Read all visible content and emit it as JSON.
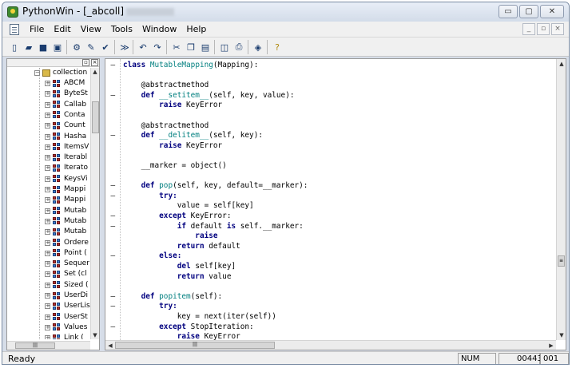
{
  "window": {
    "title": "PythonWin - [_abcoll]",
    "min_label": "▭",
    "max_label": "▢",
    "close_label": "✕"
  },
  "menu": [
    "File",
    "Edit",
    "View",
    "Tools",
    "Window",
    "Help"
  ],
  "toolbar": {
    "icons": [
      "new-file-icon",
      "open-folder-icon",
      "save-icon",
      "save-all-icon",
      "debug-icon",
      "edit-icon",
      "check-icon",
      "indent-icon",
      "undo-icon",
      "redo-icon",
      "cut-icon",
      "copy-icon",
      "paste-icon",
      "print-preview-icon",
      "print-icon",
      "browse-icon",
      "help-icon"
    ]
  },
  "tree": {
    "root": "collection",
    "items": [
      "ABCM",
      "ByteSt",
      "Callab",
      "Conta",
      "Count",
      "Hasha",
      "ItemsV",
      "Iterabl",
      "Iterato",
      "KeysVi",
      "Mappi",
      "Mappi",
      "Mutab",
      "Mutab",
      "Mutab",
      "Ordere",
      "Point (",
      "Sequer",
      "Set (cl",
      "Sized (",
      "UserDi",
      "UserLis",
      "UserSt",
      "Values",
      "Link ("
    ]
  },
  "code": [
    {
      "tokens": [
        [
          "kw",
          "class "
        ],
        [
          "nm",
          "MutableMapping"
        ],
        [
          "tx",
          "(Mapping):"
        ]
      ]
    },
    {
      "tokens": []
    },
    {
      "tokens": [
        [
          "tx",
          "    @abstractmethod"
        ]
      ]
    },
    {
      "tokens": [
        [
          "kw",
          "    def "
        ],
        [
          "fn",
          "__setitem__"
        ],
        [
          "tx",
          "(self, key, value):"
        ]
      ]
    },
    {
      "tokens": [
        [
          "kw",
          "        raise "
        ],
        [
          "tx",
          "KeyError"
        ]
      ]
    },
    {
      "tokens": []
    },
    {
      "tokens": [
        [
          "tx",
          "    @abstractmethod"
        ]
      ]
    },
    {
      "tokens": [
        [
          "kw",
          "    def "
        ],
        [
          "fn",
          "__delitem__"
        ],
        [
          "tx",
          "(self, key):"
        ]
      ]
    },
    {
      "tokens": [
        [
          "kw",
          "        raise "
        ],
        [
          "tx",
          "KeyError"
        ]
      ]
    },
    {
      "tokens": []
    },
    {
      "tokens": [
        [
          "tx",
          "    __marker = object()"
        ]
      ]
    },
    {
      "tokens": []
    },
    {
      "tokens": [
        [
          "kw",
          "    def "
        ],
        [
          "fn",
          "pop"
        ],
        [
          "tx",
          "(self, key, default=__marker):"
        ]
      ]
    },
    {
      "tokens": [
        [
          "kw",
          "        try:"
        ]
      ]
    },
    {
      "tokens": [
        [
          "tx",
          "            value = self[key]"
        ]
      ]
    },
    {
      "tokens": [
        [
          "kw",
          "        except "
        ],
        [
          "tx",
          "KeyError:"
        ]
      ]
    },
    {
      "tokens": [
        [
          "kw",
          "            if "
        ],
        [
          "tx",
          "default "
        ],
        [
          "kw",
          "is "
        ],
        [
          "tx",
          "self.__marker:"
        ]
      ]
    },
    {
      "tokens": [
        [
          "kw",
          "                raise"
        ]
      ]
    },
    {
      "tokens": [
        [
          "kw",
          "            return "
        ],
        [
          "tx",
          "default"
        ]
      ]
    },
    {
      "tokens": [
        [
          "kw",
          "        else:"
        ]
      ]
    },
    {
      "tokens": [
        [
          "kw",
          "            del "
        ],
        [
          "tx",
          "self[key]"
        ]
      ]
    },
    {
      "tokens": [
        [
          "kw",
          "            return "
        ],
        [
          "tx",
          "value"
        ]
      ]
    },
    {
      "tokens": []
    },
    {
      "tokens": [
        [
          "kw",
          "    def "
        ],
        [
          "fn",
          "popitem"
        ],
        [
          "tx",
          "(self):"
        ]
      ]
    },
    {
      "tokens": [
        [
          "kw",
          "        try:"
        ]
      ]
    },
    {
      "tokens": [
        [
          "tx",
          "            key = next(iter(self))"
        ]
      ]
    },
    {
      "tokens": [
        [
          "kw",
          "        except "
        ],
        [
          "tx",
          "StopIteration:"
        ]
      ]
    },
    {
      "tokens": [
        [
          "kw",
          "            raise "
        ],
        [
          "tx",
          "KeyError"
        ]
      ]
    }
  ],
  "folds": [
    0,
    3,
    7,
    12,
    13,
    15,
    16,
    19,
    23,
    24,
    26
  ],
  "status": {
    "text": "Ready",
    "num": "NUM",
    "pos": "00443",
    "col": "001"
  }
}
